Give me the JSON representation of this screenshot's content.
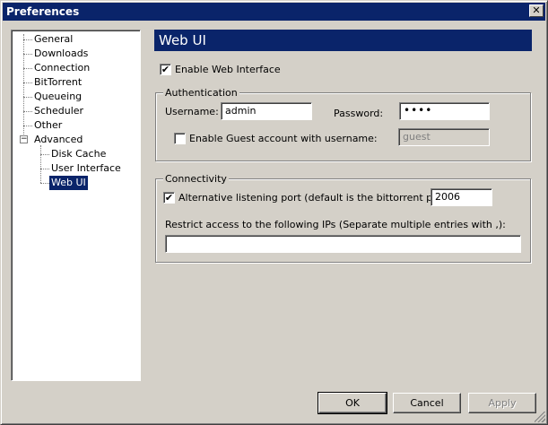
{
  "window": {
    "title": "Preferences",
    "close_glyph": "✕"
  },
  "tree": {
    "items": [
      {
        "label": "General"
      },
      {
        "label": "Downloads"
      },
      {
        "label": "Connection"
      },
      {
        "label": "BitTorrent"
      },
      {
        "label": "Queueing"
      },
      {
        "label": "Scheduler"
      },
      {
        "label": "Other"
      },
      {
        "label": "Advanced",
        "expanded": true
      },
      {
        "label": "Disk Cache"
      },
      {
        "label": "User Interface"
      },
      {
        "label": "Web UI",
        "selected": true
      }
    ],
    "expander_glyph": "−"
  },
  "panel": {
    "title": "Web UI",
    "enable_webui": {
      "label": "Enable Web Interface",
      "checked": true
    },
    "authentication": {
      "group_title": "Authentication",
      "username_label": "Username:",
      "username_value": "admin",
      "password_label": "Password:",
      "password_value": "••••",
      "guest": {
        "label": "Enable Guest account with username:",
        "checked": false,
        "value": "guest"
      }
    },
    "connectivity": {
      "group_title": "Connectivity",
      "alt_port": {
        "label": "Alternative listening port (default is the bittorrent port):",
        "checked": true,
        "value": "2006"
      },
      "restrict_label": "Restrict access to the following IPs (Separate multiple entries with ,):",
      "restrict_value": ""
    }
  },
  "buttons": {
    "ok": "OK",
    "cancel": "Cancel",
    "apply": "Apply"
  },
  "check_glyph": "✔"
}
